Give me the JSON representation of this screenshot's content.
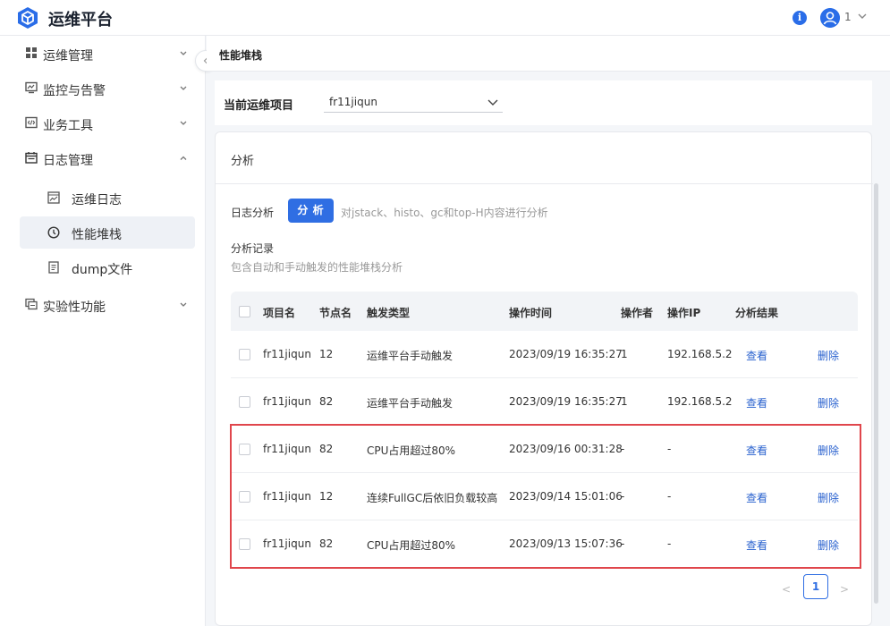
{
  "app": {
    "title": "运维平台",
    "user": "1"
  },
  "sidebar": {
    "items": [
      {
        "label": "运维管理",
        "icon": "grid-icon"
      },
      {
        "label": "监控与告警",
        "icon": "monitor-icon"
      },
      {
        "label": "业务工具",
        "icon": "code-icon"
      },
      {
        "label": "日志管理",
        "icon": "calendar-icon",
        "expanded": true,
        "children": [
          {
            "label": "运维日志",
            "icon": "chart-icon"
          },
          {
            "label": "性能堆栈",
            "icon": "clock-icon",
            "active": true
          },
          {
            "label": "dump文件",
            "icon": "file-icon"
          }
        ]
      },
      {
        "label": "实验性功能",
        "icon": "lab-icon"
      }
    ]
  },
  "breadcrumb": "性能堆栈",
  "project": {
    "label": "当前运维项目",
    "value": "fr11jiqun"
  },
  "analysis": {
    "title": "分析",
    "log_label": "日志分析",
    "button": "分 析",
    "desc": "对jstack、histo、gc和top-H内容进行分析",
    "records_title": "分析记录",
    "records_desc": "包含自动和手动触发的性能堆栈分析"
  },
  "table": {
    "headers": [
      "项目名",
      "节点名",
      "触发类型",
      "操作时间",
      "操作者",
      "操作IP",
      "分析结果"
    ],
    "rows": [
      [
        "fr11jiqun",
        "12",
        "运维平台手动触发",
        "2023/09/19 16:35:27",
        "1",
        "192.168.5.2",
        "查看",
        "删除"
      ],
      [
        "fr11jiqun",
        "82",
        "运维平台手动触发",
        "2023/09/19 16:35:27",
        "1",
        "192.168.5.2",
        "查看",
        "删除"
      ],
      [
        "fr11jiqun",
        "82",
        "CPU占用超过80%",
        "2023/09/16 00:31:28",
        "-",
        "-",
        "查看",
        "删除"
      ],
      [
        "fr11jiqun",
        "12",
        "连续FullGC后依旧负载较高",
        "2023/09/14 15:01:06",
        "-",
        "-",
        "查看",
        "删除"
      ],
      [
        "fr11jiqun",
        "82",
        "CPU占用超过80%",
        "2023/09/13 15:07:36",
        "-",
        "-",
        "查看",
        "删除"
      ]
    ]
  },
  "pagination": {
    "prev": "<",
    "current": "1",
    "next": ">"
  },
  "colors": {
    "accent": "#2f6ee3",
    "highlight": "#e0464c"
  }
}
